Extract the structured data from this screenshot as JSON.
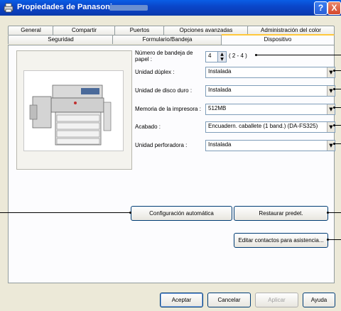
{
  "window": {
    "title": "Propiedades de Panasonic",
    "help_label": "?",
    "close_label": "X"
  },
  "tabs_row1": [
    {
      "label": "General"
    },
    {
      "label": "Compartir"
    },
    {
      "label": "Puertos"
    },
    {
      "label": "Opciones avanzadas"
    },
    {
      "label": "Administración del color"
    }
  ],
  "tabs_row2": [
    {
      "label": "Seguridad"
    },
    {
      "label": "Formulario/Bandeja"
    },
    {
      "label": "Dispositivo"
    }
  ],
  "settings": {
    "tray_count_label": "Número de bandeja de papel :",
    "tray_count_value": "4",
    "tray_count_range": "( 2 - 4 )",
    "duplex_label": "Unidad dúplex :",
    "duplex_value": "Instalada",
    "hdd_label": "Unidad de disco duro :",
    "hdd_value": "Instalada",
    "memory_label": "Memoria de la impresora :",
    "memory_value": "512MB",
    "finisher_label": "Acabado :",
    "finisher_value": "Encuadern. caballete (1 band.) (DA-FS325)",
    "punch_label": "Unidad perforadora :",
    "punch_value": "Instalada"
  },
  "buttons": {
    "auto_config": "Configuración automática",
    "restore_defaults": "Restaurar predet.",
    "edit_contacts": "Editar contactos para asistencia...",
    "ok": "Aceptar",
    "cancel": "Cancelar",
    "apply": "Aplicar",
    "help": "Ayuda"
  },
  "icons": {
    "spin_up": "▲",
    "spin_down": "▼",
    "dropdown": "▼"
  }
}
